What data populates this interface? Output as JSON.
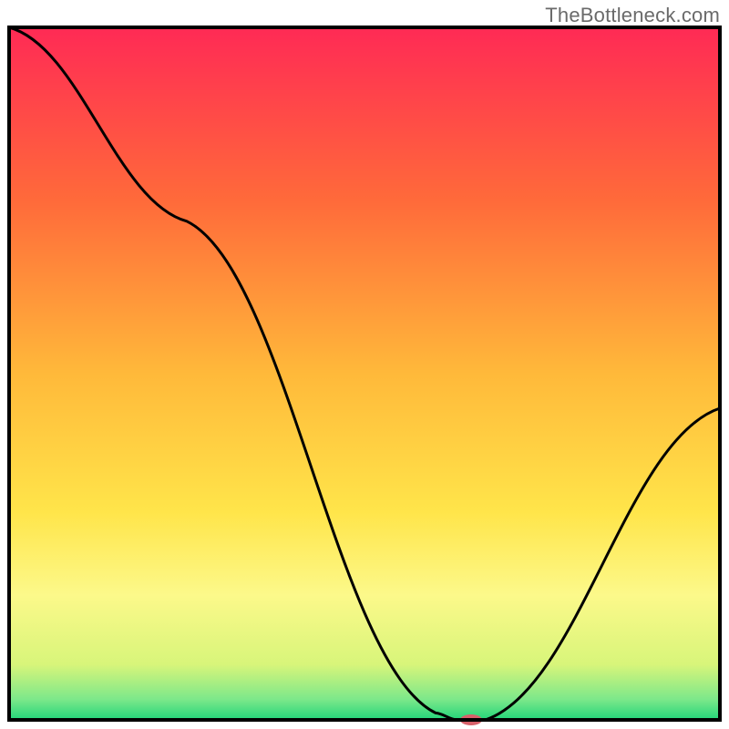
{
  "watermark": "TheBottleneck.com",
  "chart_data": {
    "type": "line",
    "title": "",
    "xlabel": "",
    "ylabel": "",
    "xlim": [
      0,
      100
    ],
    "ylim": [
      0,
      100
    ],
    "grid": false,
    "legend": false,
    "background_gradient_stops": [
      {
        "offset": 0.0,
        "color": "#ff2a55"
      },
      {
        "offset": 0.25,
        "color": "#ff6a3a"
      },
      {
        "offset": 0.5,
        "color": "#ffb93a"
      },
      {
        "offset": 0.7,
        "color": "#ffe54a"
      },
      {
        "offset": 0.82,
        "color": "#fcf98a"
      },
      {
        "offset": 0.92,
        "color": "#d8f57a"
      },
      {
        "offset": 0.97,
        "color": "#7de88a"
      },
      {
        "offset": 1.0,
        "color": "#22d57a"
      }
    ],
    "series": [
      {
        "name": "bottleneck-curve",
        "x": [
          0,
          25,
          60,
          63,
          67,
          100
        ],
        "y": [
          100,
          72,
          1,
          0,
          0,
          45
        ],
        "stroke": "#000000",
        "stroke_width": 3
      }
    ],
    "marker": {
      "name": "optimal-point",
      "x": 65,
      "y": 0,
      "color": "#d8616a",
      "rx": 12,
      "ry": 6
    },
    "frame": {
      "color": "#000000",
      "width": 4
    }
  }
}
